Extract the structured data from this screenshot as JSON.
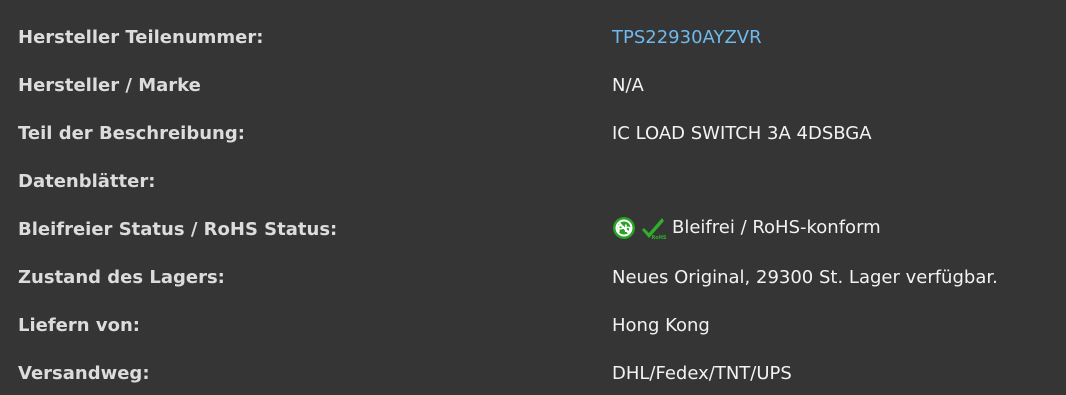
{
  "colors": {
    "background": "#353535",
    "label": "#dcdcdc",
    "value": "#f2f2f2",
    "link": "#6fb9ec",
    "icon_green": "#27a323"
  },
  "rows": [
    {
      "label": "Hersteller Teilenummer:",
      "value": "TPS22930AYZVR",
      "is_link": true
    },
    {
      "label": "Hersteller / Marke",
      "value": "N/A",
      "is_link": false
    },
    {
      "label": "Teil der Beschreibung:",
      "value": "IC LOAD SWITCH 3A 4DSBGA",
      "is_link": false
    },
    {
      "label": "Datenblätter:",
      "value": "",
      "is_link": false
    },
    {
      "label": "Bleifreier Status / RoHS Status:",
      "value": "Bleifrei / RoHS-konform",
      "is_link": false,
      "icons": [
        "lead-free-icon",
        "rohs-check-icon"
      ]
    },
    {
      "label": "Zustand des Lagers:",
      "value": "Neues Original, 29300 St. Lager verfügbar.",
      "is_link": false
    },
    {
      "label": "Liefern von:",
      "value": "Hong Kong",
      "is_link": false
    },
    {
      "label": "Versandweg:",
      "value": "DHL/Fedex/TNT/UPS",
      "is_link": false
    }
  ]
}
